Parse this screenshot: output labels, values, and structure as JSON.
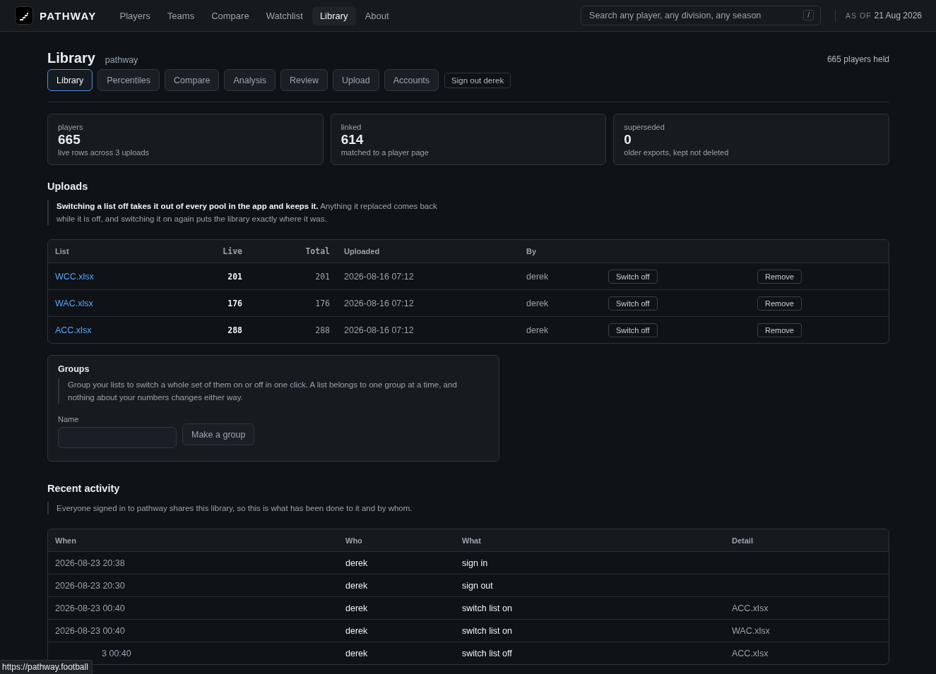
{
  "brand": {
    "name": "PATHWAY"
  },
  "nav": [
    {
      "label": "Players",
      "selected": false
    },
    {
      "label": "Teams",
      "selected": false
    },
    {
      "label": "Compare",
      "selected": false
    },
    {
      "label": "Watchlist",
      "selected": false
    },
    {
      "label": "Library",
      "selected": true
    },
    {
      "label": "About",
      "selected": false
    }
  ],
  "search": {
    "placeholder": "Search any player, any division, any season",
    "shortcut": "/"
  },
  "as_of": {
    "label": "AS OF",
    "date": "21 Aug 2026"
  },
  "page": {
    "title": "Library",
    "subtitle": "pathway",
    "held": "665 players held"
  },
  "tabs": [
    {
      "label": "Library",
      "selected": true
    },
    {
      "label": "Percentiles",
      "selected": false
    },
    {
      "label": "Compare",
      "selected": false
    },
    {
      "label": "Analysis",
      "selected": false
    },
    {
      "label": "Review",
      "selected": false
    },
    {
      "label": "Upload",
      "selected": false
    },
    {
      "label": "Accounts",
      "selected": false
    }
  ],
  "sign_out": "Sign out derek",
  "stats": [
    {
      "label": "players",
      "value": "665",
      "note": "live rows across 3 uploads"
    },
    {
      "label": "linked",
      "value": "614",
      "note": "matched to a player page"
    },
    {
      "label": "superseded",
      "value": "0",
      "note": "older exports, kept not deleted"
    }
  ],
  "uploads": {
    "title": "Uploads",
    "note": "**Switching a list off takes it out of every pool in the app and keeps it.** Anything it replaced comes back while it is off, and switching it on again puts the library exactly where it was.",
    "columns": [
      "List",
      "Live",
      "Total",
      "Uploaded",
      "By"
    ],
    "rows": [
      {
        "list": "WCC.xlsx",
        "live": "201",
        "total": "201",
        "uploaded": "2026-08-16 07:12",
        "by": "derek",
        "toggle": "Switch off",
        "remove": "Remove"
      },
      {
        "list": "WAC.xlsx",
        "live": "176",
        "total": "176",
        "uploaded": "2026-08-16 07:12",
        "by": "derek",
        "toggle": "Switch off",
        "remove": "Remove"
      },
      {
        "list": "ACC.xlsx",
        "live": "288",
        "total": "288",
        "uploaded": "2026-08-16 07:12",
        "by": "derek",
        "toggle": "Switch off",
        "remove": "Remove"
      }
    ]
  },
  "groups": {
    "title": "Groups",
    "note": "Group your lists to switch a whole set of them on or off in one click. A list belongs to one group at a time, and nothing about your numbers changes either way.",
    "name_label": "Name",
    "button": "Make a group"
  },
  "activity": {
    "title": "Recent activity",
    "note": "Everyone signed in to pathway shares this library, so this is what has been done to it and by whom.",
    "columns": [
      "When",
      "Who",
      "What",
      "Detail"
    ],
    "rows": [
      {
        "when": "2026-08-23 20:38",
        "who": "derek",
        "what": "sign in"
      },
      {
        "when": "2026-08-23 20:30",
        "who": "derek",
        "what": "sign out"
      },
      {
        "when": "2026-08-23 00:40",
        "who": "derek",
        "what": "switch list on",
        "detail": "ACC.xlsx"
      },
      {
        "when": "2026-08-23 00:40",
        "who": "derek",
        "what": "switch list on",
        "detail": "WAC.xlsx"
      },
      {
        "when": "3 00:40",
        "kind": "partial",
        "who": "derek",
        "what": "switch list off",
        "detail": "ACC.xlsx"
      }
    ]
  },
  "status_url": "https://pathway.football"
}
